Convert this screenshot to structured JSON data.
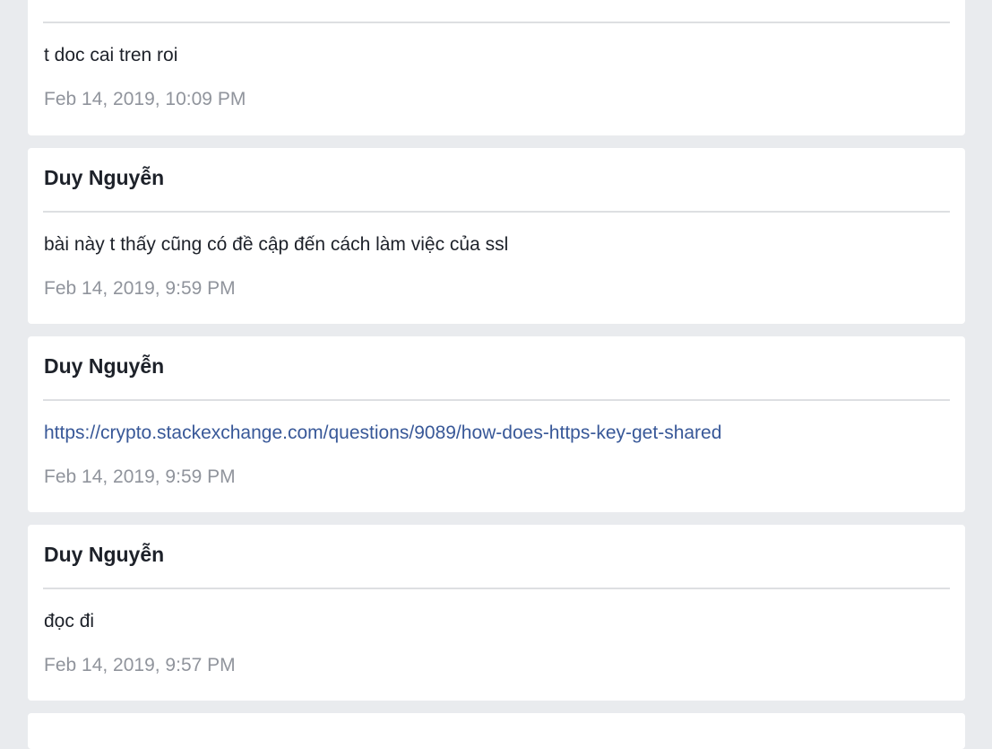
{
  "messages": [
    {
      "sender": "",
      "text": "t doc cai tren roi",
      "is_link": false,
      "timestamp": "Feb 14, 2019, 10:09 PM"
    },
    {
      "sender": "Duy Nguyễn",
      "text": "bài này t thấy cũng có đề cập đến cách làm việc của ssl",
      "is_link": false,
      "timestamp": "Feb 14, 2019, 9:59 PM"
    },
    {
      "sender": "Duy Nguyễn",
      "text": "https://crypto.stackexchange.com/questions/9089/how-does-https-key-get-shared",
      "is_link": true,
      "timestamp": "Feb 14, 2019, 9:59 PM"
    },
    {
      "sender": "Duy Nguyễn",
      "text": "đọc đi",
      "is_link": false,
      "timestamp": "Feb 14, 2019, 9:57 PM"
    }
  ],
  "colors": {
    "background": "#e9ebee",
    "card": "#ffffff",
    "text": "#1d2129",
    "link": "#385898",
    "timestamp": "#90949c",
    "divider": "#dddfe2"
  }
}
